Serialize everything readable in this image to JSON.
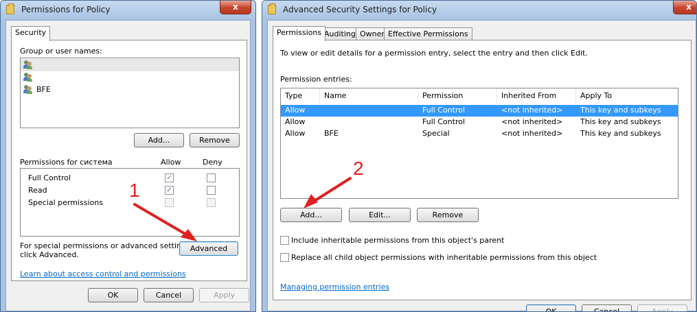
{
  "left_window": {
    "title": "Permissions for Policy",
    "close_glyph": "x",
    "tab": "Security",
    "group_label": "Group or user names:",
    "users": [
      {
        "name": "",
        "icon": "user-group-icon",
        "selected": true
      },
      {
        "name": "",
        "icon": "user-group-icon",
        "selected": false
      },
      {
        "name": "BFE",
        "icon": "user-group-icon",
        "selected": false
      }
    ],
    "add_button": "Add...",
    "remove_button": "Remove",
    "permissions_label": "Permissions for система",
    "allow_header": "Allow",
    "deny_header": "Deny",
    "permissions": [
      {
        "name": "Full Control",
        "allow": true,
        "deny": false,
        "disabled": false
      },
      {
        "name": "Read",
        "allow": true,
        "deny": false,
        "disabled": false
      },
      {
        "name": "Special permissions",
        "allow": false,
        "deny": false,
        "disabled": true
      }
    ],
    "special_text_1": "For special permissions or advanced settings,",
    "special_text_2": "click Advanced.",
    "advanced_button": "Advanced",
    "learn_link": "Learn about access control and permissions",
    "ok_button": "OK",
    "cancel_button": "Cancel",
    "apply_button": "Apply"
  },
  "right_window": {
    "title": "Advanced Security Settings for Policy",
    "close_glyph": "x",
    "tabs": [
      "Permissions",
      "Auditing",
      "Owner",
      "Effective Permissions"
    ],
    "instruction": "To view or edit details for a permission entry, select the entry and then click Edit.",
    "entries_label": "Permission entries:",
    "columns": [
      "Type",
      "Name",
      "Permission",
      "Inherited From",
      "Apply To"
    ],
    "entries": [
      {
        "type": "Allow",
        "name": "",
        "permission": "Full Control",
        "inherited": "<not inherited>",
        "apply_to": "This key and subkeys",
        "selected": true
      },
      {
        "type": "Allow",
        "name": "",
        "permission": "Full Control",
        "inherited": "<not inherited>",
        "apply_to": "This key and subkeys",
        "selected": false
      },
      {
        "type": "Allow",
        "name": "BFE",
        "permission": "Special",
        "inherited": "<not inherited>",
        "apply_to": "This key and subkeys",
        "selected": false
      }
    ],
    "add_button": "Add...",
    "edit_button": "Edit...",
    "remove_button": "Remove",
    "include_inheritable": "Include inheritable permissions from this object's parent",
    "replace_child": "Replace all child object permissions with inheritable permissions from this object",
    "manage_link": "Managing permission entries",
    "ok_button": "OK",
    "cancel_button": "Cancel",
    "apply_button": "Apply"
  },
  "annotations": {
    "step1": "1",
    "step2": "2",
    "color": "#e02020"
  }
}
